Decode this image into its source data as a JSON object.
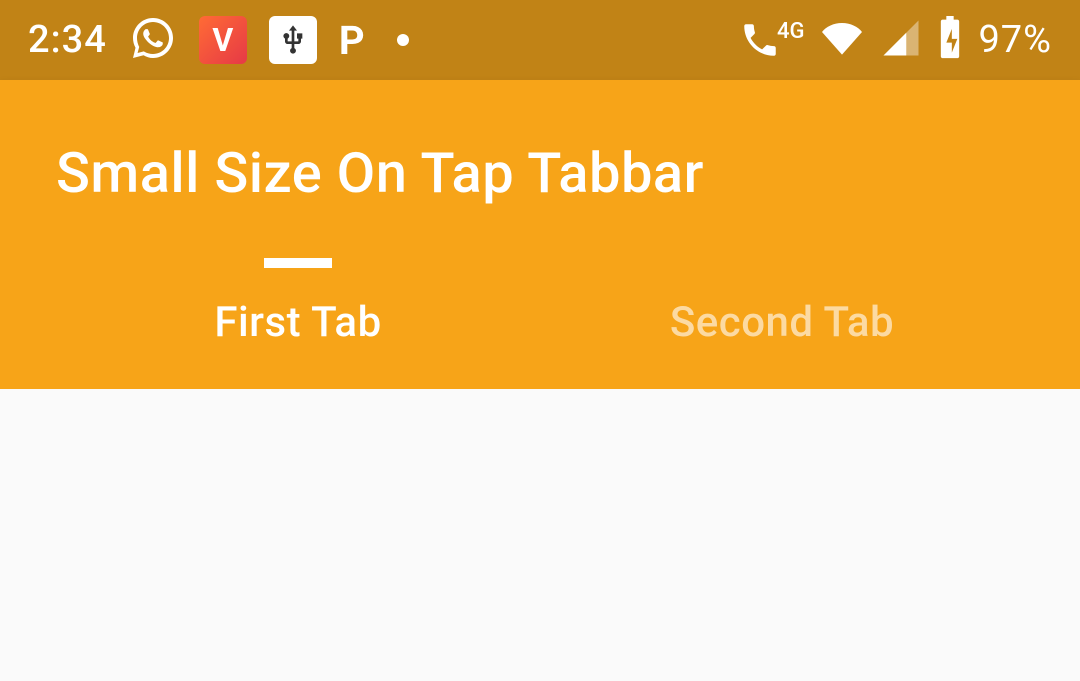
{
  "statusBar": {
    "time": "2:34",
    "batteryPercent": "97%",
    "networkLabel": "4G"
  },
  "appBar": {
    "title": "Small Size On Tap Tabbar"
  },
  "tabs": [
    {
      "label": "First Tab",
      "active": true
    },
    {
      "label": "Second Tab",
      "active": false
    }
  ]
}
